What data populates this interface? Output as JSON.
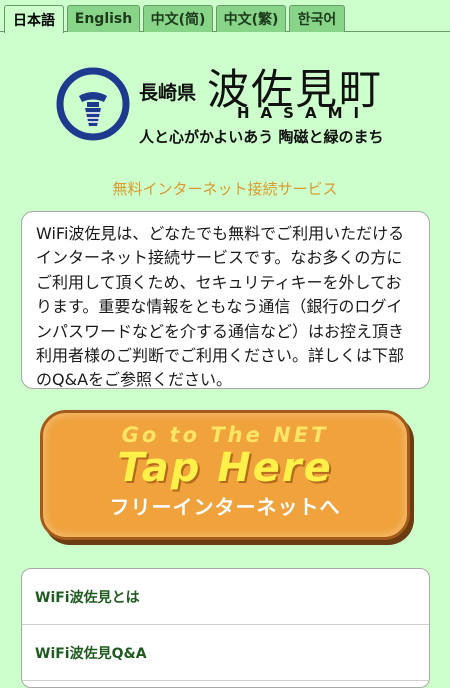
{
  "language_tabs": [
    {
      "label": "日本語",
      "active": true
    },
    {
      "label": "English",
      "active": false
    },
    {
      "label": "中文(简)",
      "active": false
    },
    {
      "label": "中文(繁)",
      "active": false
    },
    {
      "label": "한국어",
      "active": false
    }
  ],
  "logo": {
    "prefecture": "長崎県",
    "town_name": "波佐見町",
    "town_roman": "HASAMI",
    "slogan": "人と心がかよいあう 陶磁と緑のまち"
  },
  "service_title": "無料インターネット接続サービス",
  "info_text": "WiFi波佐見は、どなたでも無料でご利用いただけるインターネット接続サービスです。なお多くの方にご利用して頂くため、セキュリティキーを外しております。重要な情報をともなう通信（銀行のログインパスワードなどを介する通信など）はお控え頂き利用者様のご判断でご利用ください。詳しくは下部のQ&Aをご参照ください。",
  "cta": {
    "line1": "Go to The NET",
    "line2": "Tap Here",
    "line3": "フリーインターネットへ"
  },
  "menu": [
    {
      "label": "WiFi波佐見とは"
    },
    {
      "label": "WiFi波佐見Q&A"
    }
  ],
  "colors": {
    "background": "#ccffcc",
    "tab_inactive": "#88d488",
    "title_orange": "#d99a2e",
    "button_orange": "#f0a23c",
    "menu_text": "#1f5b1f"
  }
}
